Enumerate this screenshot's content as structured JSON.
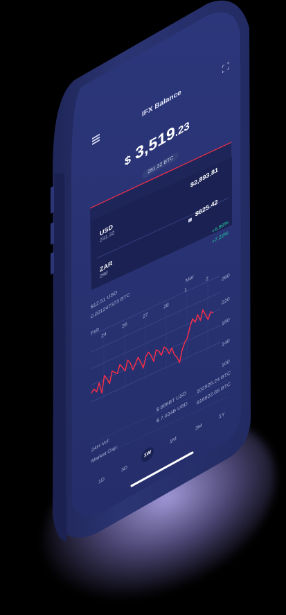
{
  "app": {
    "title": "IFX Balance"
  },
  "balance": {
    "currency_symbol": "$",
    "whole": "3,519",
    "cents": ".23",
    "btc_pill": "281.32 BTC"
  },
  "accounts": {
    "top_value": "$2,893.81",
    "second_value": "$625.42",
    "items": [
      {
        "code": "USD",
        "sub": "231.32",
        "change": "+5.89%"
      },
      {
        "code": "ZAR",
        "sub": "28d",
        "change": "+7.22%"
      }
    ]
  },
  "chart_header": {
    "price_usd": "$12.51 USD",
    "price_btc": "0.001247373 BTC"
  },
  "chart_data": {
    "type": "line",
    "x_tick_labels": [
      "Feb",
      "24",
      "26",
      "27",
      "28",
      "1",
      "Mar",
      "2"
    ],
    "y_tick_labels": [
      "260",
      "220",
      "180",
      "140",
      "100"
    ],
    "ylim": [
      100,
      260
    ],
    "series": [
      {
        "values": [
          121,
          128,
          118,
          137,
          110,
          149,
          138,
          124,
          151,
          145,
          139,
          158,
          148,
          137,
          160,
          150,
          131,
          143,
          155,
          141,
          124,
          148,
          156,
          145,
          128,
          153,
          147,
          134,
          151,
          144,
          129,
          140,
          121,
          112,
          96,
          124,
          139,
          147,
          170,
          187,
          176,
          191,
          174,
          197,
          182,
          168,
          184,
          178
        ]
      }
    ]
  },
  "stats": {
    "volume_label": "24H Vol:",
    "volume_usd": "$ 886BT USD",
    "volume_btc": "102926.24 BTC",
    "marketcap_label": "Market Cap:",
    "marketcap_usd": "$ 7.034B USD",
    "marketcap_btc": "816922.65 BTC"
  },
  "ranges": {
    "items": [
      "1D",
      "3D",
      "1W",
      "1M",
      "3M",
      "1Y"
    ],
    "selected": "1W"
  },
  "colors": {
    "screen": "#27306b",
    "bezel": "#242c66",
    "line": "#ff2d45",
    "positive": "#23d3a3"
  },
  "icons": {
    "menu": "hamburger-menu-icon",
    "fullscreen": "expand-icon",
    "lock": "lock-icon"
  }
}
